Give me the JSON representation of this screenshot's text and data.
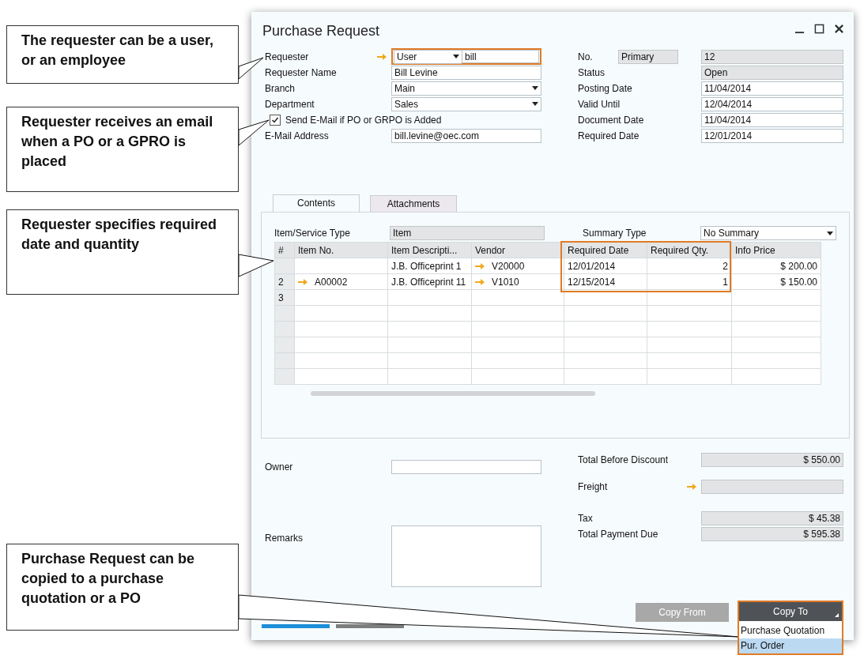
{
  "callouts": [
    {
      "text": "The requester can be a user, or an employee"
    },
    {
      "text": "Requester receives an email when a PO or a GPRO is placed"
    },
    {
      "text": "Requester specifies required date and quantity"
    },
    {
      "text": "Purchase Request can be copied to a purchase quotation or a PO"
    }
  ],
  "window": {
    "title": "Purchase Request"
  },
  "header_left": [
    {
      "kind": "requester",
      "label": "Requester",
      "type": "User",
      "code": "bill"
    },
    {
      "kind": "text",
      "label": "Requester Name",
      "value": "Bill Levine"
    },
    {
      "kind": "dropdown",
      "label": "Branch",
      "value": "Main"
    },
    {
      "kind": "dropdown",
      "label": "Department",
      "value": "Sales"
    },
    {
      "kind": "checkbox",
      "label": "Send E-Mail if PO or GRPO is Added",
      "checked": true
    },
    {
      "kind": "text",
      "label": "E-Mail Address",
      "value": "bill.levine@oec.com"
    }
  ],
  "header_right": [
    {
      "kind": "series",
      "label": "No.",
      "series": "Primary",
      "value": "12",
      "disabled": true
    },
    {
      "kind": "text",
      "label": "Status",
      "value": "Open",
      "disabled": true
    },
    {
      "kind": "text",
      "label": "Posting Date",
      "value": "11/04/2014",
      "disabled": false
    },
    {
      "kind": "text",
      "label": "Valid Until",
      "value": "12/04/2014",
      "disabled": false
    },
    {
      "kind": "text",
      "label": "Document Date",
      "value": "11/04/2014",
      "disabled": false
    },
    {
      "kind": "text",
      "label": "Required Date",
      "value": "12/01/2014",
      "disabled": false
    }
  ],
  "tabs": [
    {
      "label": "Contents",
      "selected": true
    },
    {
      "label": "Attachments",
      "selected": false
    }
  ],
  "item_service_type": {
    "label": "Item/Service Type",
    "value": "Item"
  },
  "summary_type": {
    "label": "Summary Type",
    "value": "No Summary"
  },
  "table": {
    "columns": [
      "#",
      "Item No.",
      "Item Descripti...",
      "Vendor",
      "Required Date",
      "Required Qty.",
      "Info Price"
    ],
    "rows": [
      {
        "cells": [
          null,
          null,
          "J.B. Officeprint 1",
          "V20000",
          "12/01/2014",
          "2",
          "$ 200.00"
        ],
        "item_link": false,
        "vendor_link": true
      },
      {
        "cells": [
          "2",
          "A00002",
          "J.B. Officeprint 11",
          "V1010",
          "12/15/2014",
          "1",
          "$ 150.00"
        ],
        "item_link": true,
        "vendor_link": true
      },
      {
        "cells": [
          "3",
          null,
          null,
          null,
          null,
          null,
          null
        ],
        "item_link": false,
        "vendor_link": false
      }
    ]
  },
  "owner": {
    "label": "Owner"
  },
  "remarks": {
    "label": "Remarks"
  },
  "totals": [
    {
      "label": "Total Before Discount",
      "value": "$ 550.00",
      "link": false
    },
    {
      "label": "Freight",
      "link": true
    },
    {
      "label": "Tax",
      "value": "$ 45.38",
      "link": false
    },
    {
      "label": "Total Payment Due",
      "value": "$ 595.38",
      "link": false
    }
  ],
  "copy_from": {
    "label": "Copy From",
    "disabled": true
  },
  "copy_to": {
    "label": "Copy To",
    "expanded": true,
    "menu": [
      {
        "label": "Purchase Quotation",
        "selected": false
      },
      {
        "label": "Pur. Order",
        "selected": true
      }
    ]
  }
}
